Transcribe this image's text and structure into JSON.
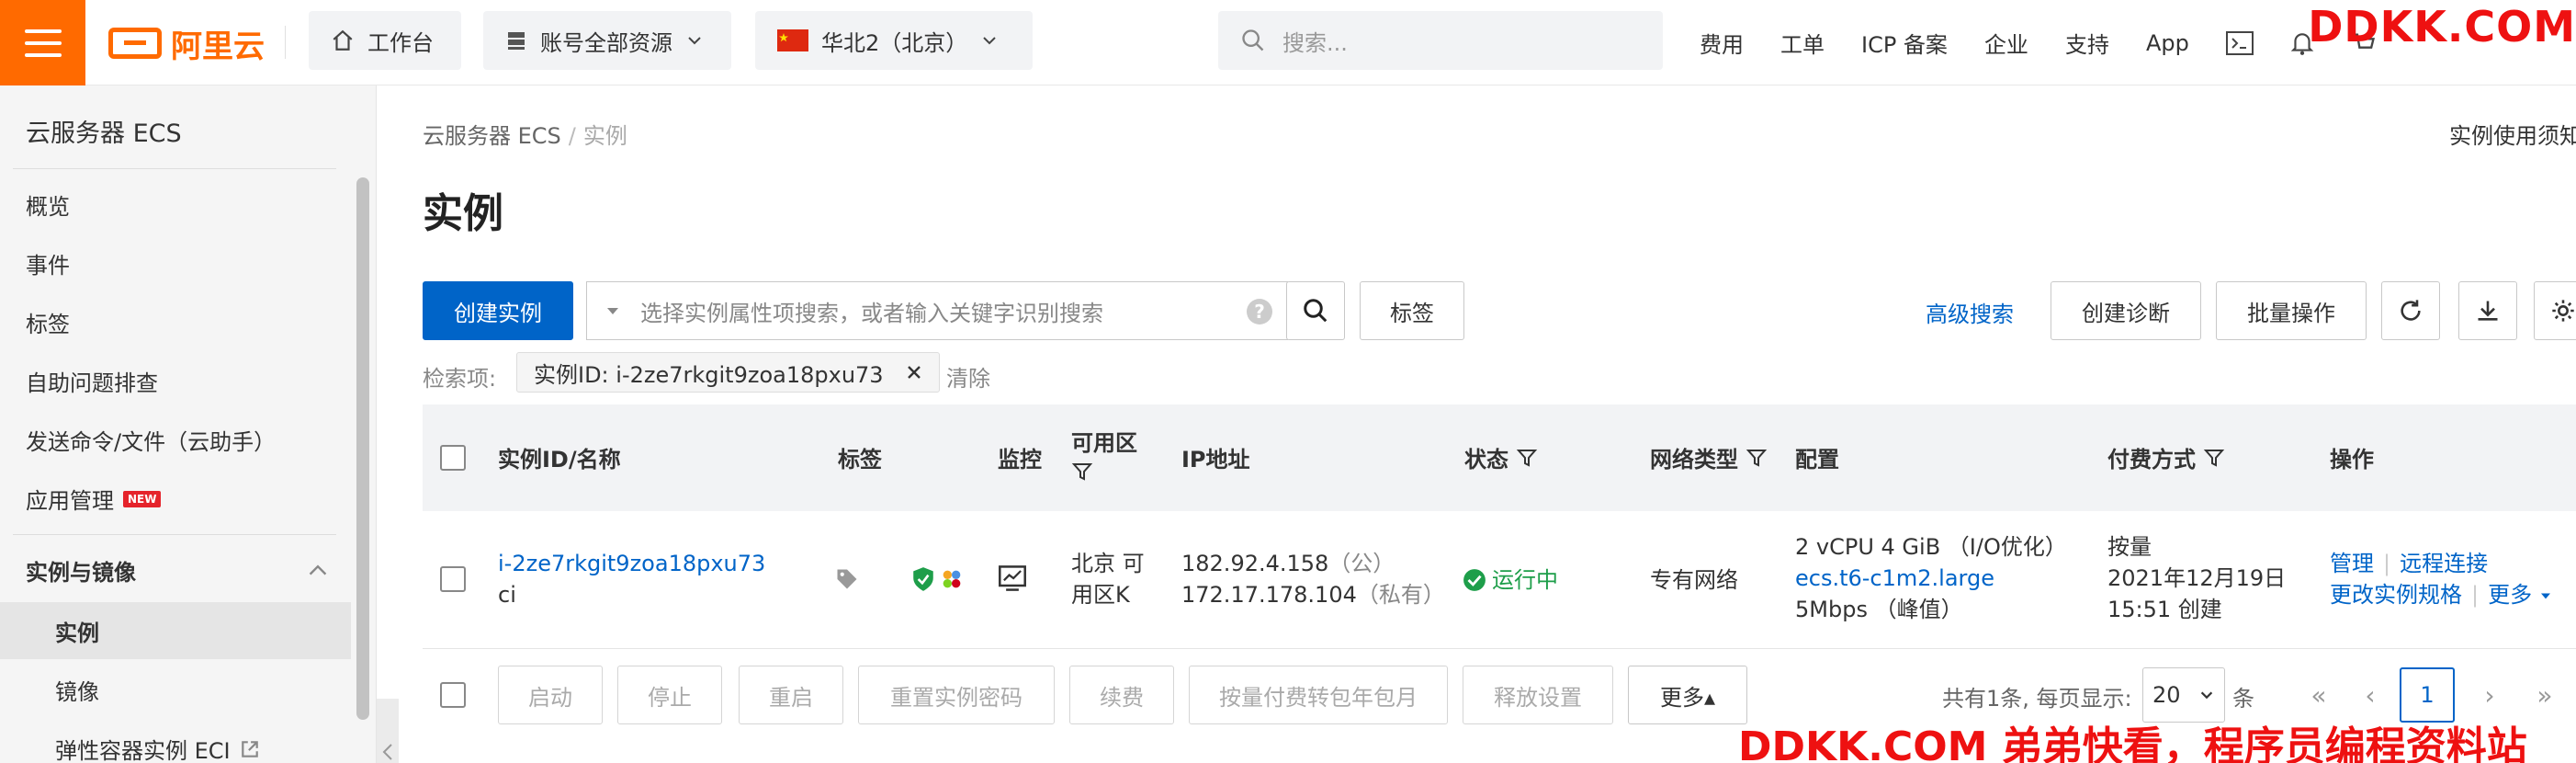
{
  "topbar": {
    "logo_text": "阿里云",
    "workbench": "工作台",
    "resource_scope": "账号全部资源",
    "region": "华北2（北京）",
    "search_placeholder": "搜索...",
    "nav": [
      "费用",
      "工单",
      "ICP 备案",
      "企业",
      "支持",
      "App"
    ],
    "watermark": "DDKK.COM"
  },
  "sidebar": {
    "title": "云服务器 ECS",
    "items": [
      {
        "label": "概览"
      },
      {
        "label": "事件"
      },
      {
        "label": "标签"
      },
      {
        "label": "自助问题排查"
      },
      {
        "label": "发送命令/文件（云助手）"
      },
      {
        "label": "应用管理",
        "badge": "NEW"
      }
    ],
    "group": "实例与镜像",
    "sub_items": [
      {
        "label": "实例",
        "active": true
      },
      {
        "label": "镜像"
      },
      {
        "label": "弹性容器实例 ECI"
      }
    ]
  },
  "breadcrumb": {
    "root": "云服务器 ECS",
    "current": "实例"
  },
  "notice": "实例使用须知",
  "page_title": "实例",
  "toolbar": {
    "create": "创建实例",
    "filter_placeholder": "选择实例属性项搜索，或者输入关键字识别搜索",
    "tag": "标签",
    "advanced": "高级搜索",
    "diagnose": "创建诊断",
    "batch": "批量操作"
  },
  "criteria": {
    "label": "检索项:",
    "chip": "实例ID: i-2ze7rkgit9zoa18pxu73",
    "clear": "清除"
  },
  "table": {
    "headers": {
      "id": "实例ID/名称",
      "tag": "标签",
      "monitor": "监控",
      "zone_1": "可用区",
      "ip": "IP地址",
      "status": "状态",
      "network": "网络类型",
      "config": "配置",
      "billing": "付费方式",
      "actions": "操作"
    },
    "rows": [
      {
        "id": "i-2ze7rkgit9zoa18pxu73",
        "name": "ci",
        "zone_1": "北京 可",
        "zone_2": "用区K",
        "ip_public": "182.92.4.158",
        "ip_public_tag": "（公）",
        "ip_private": "172.17.178.104",
        "ip_private_tag": "（私有）",
        "status": "运行中",
        "network": "专有网络",
        "config_1": "2 vCPU 4 GiB （I/O优化）",
        "config_type": "ecs.t6-c1m2.large",
        "config_bw": "5Mbps （峰值）",
        "billing_1": "按量",
        "billing_2": "2021年12月19日",
        "billing_3": "15:51 创建",
        "action_manage": "管理",
        "action_remote": "远程连接",
        "action_resize": "更改实例规格",
        "action_more": "更多"
      }
    ]
  },
  "footer": {
    "buttons": [
      "启动",
      "停止",
      "重启",
      "重置实例密码",
      "续费",
      "按量付费转包年包月",
      "释放设置"
    ],
    "more": "更多▴",
    "total": "共有1条, 每页显示:",
    "page_size": "20",
    "unit": "条",
    "current_page": "1"
  },
  "watermark_bottom": "DDKK.COM 弟弟快看，程序员编程资料站",
  "colors": {
    "brand": "#ff6a00",
    "primary": "#0064c8",
    "running": "#1e9e4a"
  }
}
